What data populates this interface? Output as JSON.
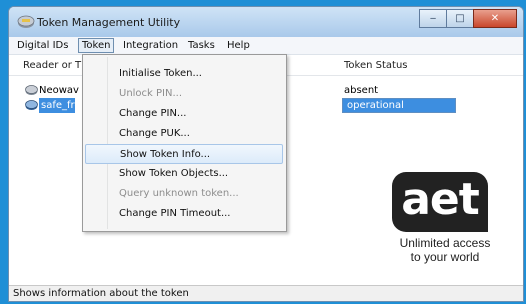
{
  "window": {
    "title": "Token Management Utility"
  },
  "window_controls": {
    "minimize": "‒",
    "maximize": "□",
    "close": "✕"
  },
  "menubar": {
    "items": [
      {
        "label": "Digital IDs"
      },
      {
        "label": "Token"
      },
      {
        "label": "Integration"
      },
      {
        "label": "Tasks"
      },
      {
        "label": "Help"
      }
    ]
  },
  "table": {
    "headers": [
      "Reader or T",
      "Token Status"
    ],
    "rows": [
      {
        "reader": "Neowav",
        "status": "absent",
        "selected": false
      },
      {
        "reader": "safe_fro",
        "status": "operational",
        "selected": true
      }
    ]
  },
  "token_menu": {
    "items": [
      {
        "label": "Initialise Token...",
        "enabled": true,
        "highlighted": false
      },
      {
        "label": "Unlock PIN...",
        "enabled": false,
        "highlighted": false
      },
      {
        "label": "Change PIN...",
        "enabled": true,
        "highlighted": false
      },
      {
        "label": "Change PUK...",
        "enabled": true,
        "highlighted": false
      },
      {
        "label": "Show Token Info...",
        "enabled": true,
        "highlighted": true
      },
      {
        "label": "Show Token Objects...",
        "enabled": true,
        "highlighted": false
      },
      {
        "label": "Query unknown token...",
        "enabled": false,
        "highlighted": false
      },
      {
        "label": "Change PIN Timeout...",
        "enabled": true,
        "highlighted": false
      }
    ]
  },
  "logo": {
    "text": "aet",
    "tagline_line1": "Unlimited access",
    "tagline_line2": "to your world"
  },
  "statusbar": {
    "text": "Shows information about the token"
  },
  "colors": {
    "selection": "#3d8ee0",
    "background": "#1f8fd6",
    "highlight_border": "#a8c6e8"
  }
}
